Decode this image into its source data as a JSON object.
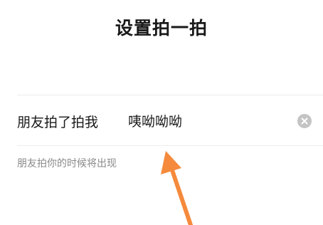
{
  "header": {
    "title": "设置拍一拍"
  },
  "form": {
    "label": "朋友拍了拍我",
    "value": "咦呦呦呦",
    "hint": "朋友拍你的时候将出现",
    "clear_icon": "clear-icon"
  },
  "colors": {
    "arrow": "#f58a3c",
    "clear_button": "#c4c4c4",
    "hint_text": "#8a8a8a"
  }
}
